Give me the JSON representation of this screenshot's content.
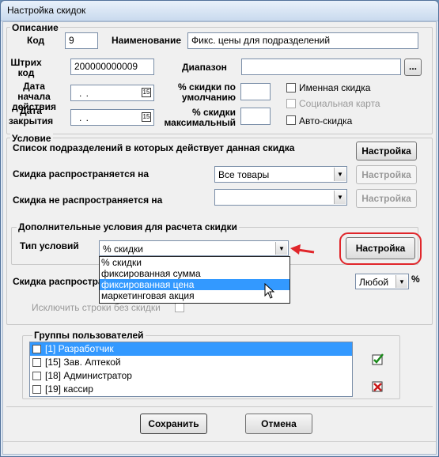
{
  "window": {
    "title": "Настройка скидок"
  },
  "description": {
    "legend": "Описание",
    "code_label": "Код",
    "code_value": "9",
    "name_label": "Наименование",
    "name_value": "Фикс. цены для подразделений",
    "barcode_label": "Штрих код",
    "barcode_value": "200000000009",
    "range_label": "Диапазон",
    "range_button": "...",
    "start_date_label": "Дата начала действия",
    "start_date_value": ". .",
    "end_date_label": "Дата закрытия",
    "end_date_value": ". .",
    "calendar_icon_text": "15",
    "default_pct_label": "% скидки по умолчанию",
    "max_pct_label": "% скидки максимальный",
    "named_discount_label": "Именная скидка",
    "social_card_label": "Социальная карта",
    "auto_discount_label": "Авто-скидка"
  },
  "condition": {
    "legend": "Условие",
    "departments_label": "Список подразделений в которых действует данная скидка",
    "settings_button": "Настройка",
    "applies_to_label": "Скидка распространяется на",
    "applies_to_value": "Все товары",
    "not_applies_label": "Скидка не распространяется на",
    "not_applies_value": "",
    "additional_legend": "Дополнительные условия для расчета  скидки",
    "condition_type_label": "Тип условий",
    "condition_type_value": "% скидки",
    "condition_type_options": [
      "% скидки",
      "фиксированная сумма",
      "фиксированная цена",
      "маркетинговая акция"
    ],
    "highlighted_option_index": 2,
    "extends_label": "Скидка распространяется",
    "extends_value": "Любой",
    "percent_sign": "%",
    "exclude_label": "Исключить строки без скидки"
  },
  "groups": {
    "legend": "Группы пользователей",
    "items": [
      {
        "label": "[1] Разработчик",
        "selected": true
      },
      {
        "label": "[15] Зав. Аптекой",
        "selected": false
      },
      {
        "label": "[18] Администратор",
        "selected": false
      },
      {
        "label": "[19] кассир",
        "selected": false
      }
    ]
  },
  "buttons": {
    "save": "Сохранить",
    "cancel": "Отмена"
  },
  "colors": {
    "highlight": "#3399ff",
    "annotation_red": "#e0262b",
    "titlebar": "#c9daee"
  },
  "icons": [
    "calendar-icon",
    "dropdown-arrow-icon",
    "check-all-icon",
    "uncheck-all-icon",
    "mouse-cursor-icon",
    "red-arrow-annotation"
  ]
}
